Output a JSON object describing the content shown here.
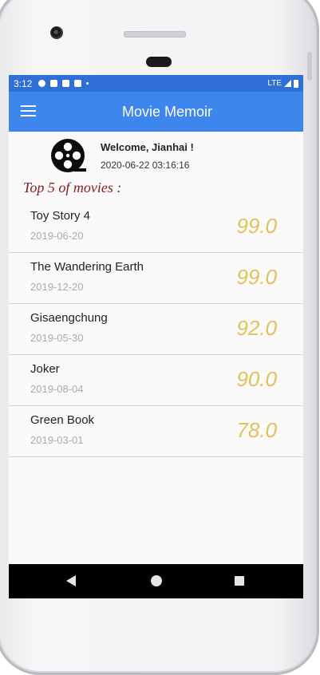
{
  "status_bar": {
    "time": "3:12",
    "network": "LTE",
    "icons": [
      "settings-icon",
      "android-icon",
      "android-icon",
      "sd-card-icon",
      "dot-icon",
      "signal-icon",
      "battery-icon"
    ]
  },
  "app_bar": {
    "title": "Movie Memoir",
    "menu_icon": "hamburger-menu-icon"
  },
  "welcome": {
    "greeting": "Welcome, Jianhai !",
    "datetime": "2020-06-22 03:16:16",
    "logo_icon": "film-reel-icon"
  },
  "section_title": "Top 5 of movies :",
  "movies": [
    {
      "title": "Toy Story 4",
      "date": "2019-06-20",
      "score": "99.0"
    },
    {
      "title": "The Wandering Earth",
      "date": "2019-12-20",
      "score": "99.0"
    },
    {
      "title": "Gisaengchung",
      "date": "2019-05-30",
      "score": "92.0"
    },
    {
      "title": "Joker",
      "date": "2019-08-04",
      "score": "90.0"
    },
    {
      "title": "Green Book",
      "date": "2019-03-01",
      "score": "78.0"
    }
  ],
  "colors": {
    "status_bar": "#2f6fd6",
    "app_bar": "#3d86ee",
    "section_title": "#8c1a26",
    "score": "#e3c25a"
  },
  "nav_bar": {
    "icons": [
      "back-icon",
      "home-icon",
      "recent-apps-icon"
    ]
  }
}
